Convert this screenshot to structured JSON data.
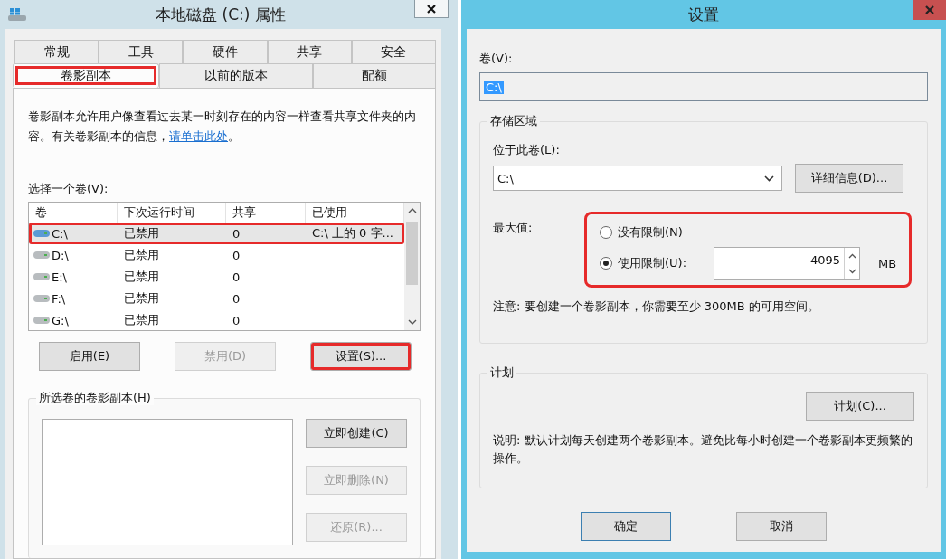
{
  "properties_window": {
    "title": "本地磁盘 (C:) 属性",
    "tabs_row1": [
      {
        "label": "常规",
        "selected": false
      },
      {
        "label": "工具",
        "selected": false
      },
      {
        "label": "硬件",
        "selected": false
      },
      {
        "label": "共享",
        "selected": false
      },
      {
        "label": "安全",
        "selected": false
      }
    ],
    "tabs_row2": [
      {
        "label": "卷影副本",
        "selected": true,
        "highlighted": true
      },
      {
        "label": "以前的版本",
        "selected": false,
        "highlighted": false
      },
      {
        "label": "配额",
        "selected": false,
        "highlighted": false
      }
    ],
    "description": "卷影副本允许用户像查看过去某一时刻存在的内容一样查看共享文件夹的内容。有关卷影副本的信息，",
    "link": "请单击此处",
    "description_end": "。",
    "volume_label": "选择一个卷(V):",
    "volumes": {
      "columns": [
        "卷",
        "下次运行时间",
        "共享",
        "已使用"
      ],
      "rows": [
        {
          "volume": "C:\\",
          "next_run": "已禁用",
          "shares": "0",
          "used": "C:\\ 上的 0 字...",
          "selected": true,
          "highlighted": true
        },
        {
          "volume": "D:\\",
          "next_run": "已禁用",
          "shares": "0",
          "selected": false,
          "highlighted": false
        },
        {
          "volume": "E:\\",
          "next_run": "已禁用",
          "shares": "0",
          "selected": false,
          "highlighted": false
        },
        {
          "volume": "F:\\",
          "next_run": "已禁用",
          "shares": "0",
          "selected": false,
          "highlighted": false
        },
        {
          "volume": "G:\\",
          "next_run": "已禁用",
          "shares": "0",
          "selected": false,
          "highlighted": false
        }
      ]
    },
    "buttons": [
      {
        "label": "启用(E)",
        "disabled": false,
        "highlighted": false
      },
      {
        "label": "禁用(D)",
        "disabled": true,
        "highlighted": false
      },
      {
        "label": "设置(S)...",
        "disabled": false,
        "highlighted": true
      }
    ],
    "copies_group": {
      "title": "所选卷的卷影副本(H)",
      "buttons": [
        {
          "label": "立即创建(C)",
          "disabled": false
        },
        {
          "label": "立即删除(N)",
          "disabled": true
        },
        {
          "label": "还原(R)...",
          "disabled": true
        }
      ]
    }
  },
  "settings_window": {
    "title": "设置",
    "volume_label": "卷(V):",
    "volume_value": "C:\\",
    "storage": {
      "title": "存储区域",
      "location_label": "位于此卷(L):",
      "location_value": "C:\\",
      "details_button": "详细信息(D)...",
      "max_label": "最大值:",
      "highlighted": true,
      "limit_options": [
        {
          "label": "没有限制(N)",
          "selected": false
        },
        {
          "label": "使用限制(U):",
          "selected": true
        }
      ],
      "limit_value": "4095",
      "unit": "MB",
      "note": "注意: 要创建一个卷影副本，你需要至少 300MB 的可用空间。"
    },
    "schedule": {
      "title": "计划",
      "button": "计划(C)...",
      "note": "说明: 默认计划每天创建两个卷影副本。避免比每小时创建一个卷影副本更频繁的操作。"
    },
    "ok_button": "确定",
    "cancel_button": "取消"
  }
}
